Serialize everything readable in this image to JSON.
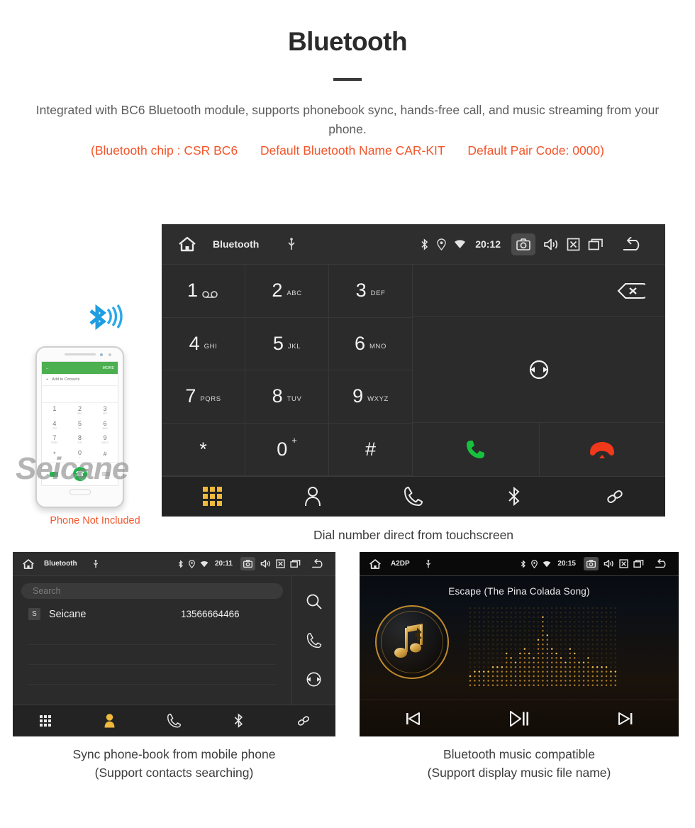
{
  "header": {
    "title": "Bluetooth",
    "intro": "Integrated with BC6 Bluetooth module, supports phonebook sync, hands-free call, and music streaming from your phone.",
    "spec_chip": "(Bluetooth chip : CSR BC6",
    "spec_name": "Default Bluetooth Name CAR-KIT",
    "spec_pair": "Default Pair Code: 0000)",
    "accent_color": "#f4552a",
    "text_color": "#5c5c5c"
  },
  "phone_mockup": {
    "note": "Phone Not Included",
    "app_bar_more": "MORE",
    "add_contacts": "Add to Contacts",
    "keys": [
      {
        "num": "1",
        "sub": ""
      },
      {
        "num": "2",
        "sub": "ABC"
      },
      {
        "num": "3",
        "sub": "DEF"
      },
      {
        "num": "4",
        "sub": "GHI"
      },
      {
        "num": "5",
        "sub": "JKL"
      },
      {
        "num": "6",
        "sub": "MNO"
      },
      {
        "num": "7",
        "sub": "PQRS"
      },
      {
        "num": "8",
        "sub": "TUV"
      },
      {
        "num": "9",
        "sub": "WXYZ"
      },
      {
        "num": "*",
        "sub": ""
      },
      {
        "num": "0",
        "sub": "+"
      },
      {
        "num": "#",
        "sub": ""
      }
    ]
  },
  "main_unit": {
    "statusbar": {
      "title": "Bluetooth",
      "time": "20:12",
      "icons": [
        "home-icon",
        "usb-icon",
        "bluetooth-icon",
        "location-icon",
        "wifi-icon",
        "camera-icon",
        "volume-icon",
        "close-box-icon",
        "recents-icon",
        "back-icon"
      ]
    },
    "dialpad": [
      {
        "num": "1",
        "sub": "",
        "voicemail": true
      },
      {
        "num": "2",
        "sub": "ABC"
      },
      {
        "num": "3",
        "sub": "DEF"
      },
      {
        "num": "4",
        "sub": "GHI"
      },
      {
        "num": "5",
        "sub": "JKL"
      },
      {
        "num": "6",
        "sub": "MNO"
      },
      {
        "num": "7",
        "sub": "PQRS"
      },
      {
        "num": "8",
        "sub": "TUV"
      },
      {
        "num": "9",
        "sub": "WXYZ"
      },
      {
        "num": "*",
        "sub": ""
      },
      {
        "num": "0",
        "sub": "+"
      },
      {
        "num": "#",
        "sub": ""
      }
    ],
    "number_display": "",
    "right_actions": [
      "backspace-icon",
      "sync-icon",
      "call-icon",
      "hangup-icon"
    ],
    "call_color": "#17c13e",
    "hangup_color": "#f0391a",
    "navbar": [
      "dialpad-icon",
      "contacts-icon",
      "call-log-icon",
      "bluetooth-icon",
      "link-icon"
    ],
    "navbar_active_index": 0,
    "active_color": "#f0b93b",
    "watermark": "Seicane",
    "caption": "Dial number direct from touchscreen"
  },
  "phonebook_unit": {
    "statusbar": {
      "title": "Bluetooth",
      "time": "20:11"
    },
    "search_placeholder": "Search",
    "contacts": [
      {
        "initial": "S",
        "name": "Seicane",
        "number": "13566664466"
      }
    ],
    "side_actions": [
      "search-icon",
      "call-icon",
      "sync-icon"
    ],
    "navbar": [
      "dialpad-icon",
      "contacts-icon",
      "call-log-icon",
      "bluetooth-icon",
      "link-icon"
    ],
    "navbar_active_index": 1,
    "caption_line1": "Sync phone-book from mobile phone",
    "caption_line2": "(Support contacts searching)"
  },
  "music_unit": {
    "statusbar": {
      "title": "A2DP",
      "time": "20:15"
    },
    "song_title": "Escape (The Pina Colada Song)",
    "controls": [
      "previous-icon",
      "play-pause-icon",
      "next-icon"
    ],
    "accent_color": "#c08b2c",
    "caption_line1": "Bluetooth music compatible",
    "caption_line2": "(Support display music file name)"
  }
}
